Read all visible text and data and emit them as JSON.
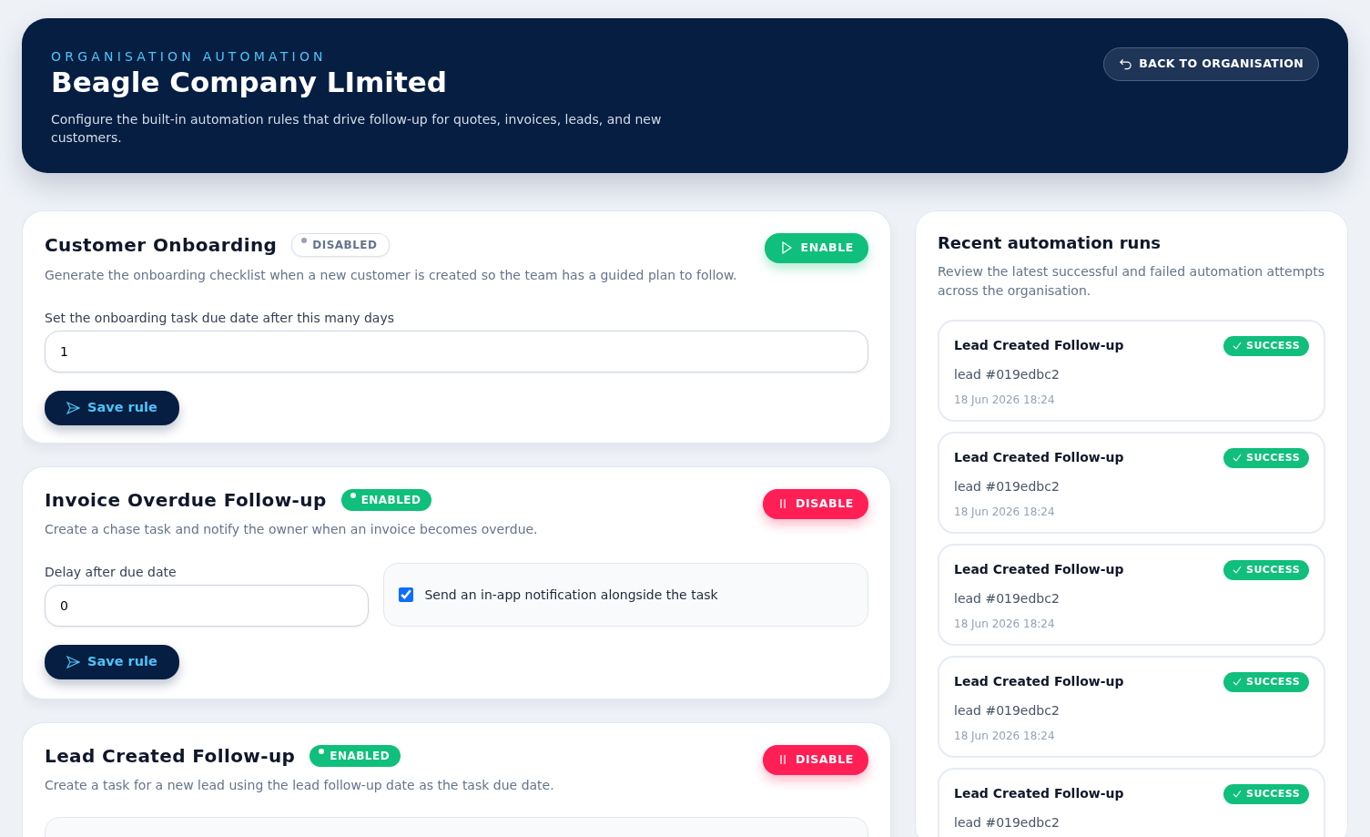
{
  "header": {
    "eyebrow": "ORGANISATION AUTOMATION",
    "title": "Beagle Company LImited",
    "description": "Configure the built-in automation rules that drive follow-up for quotes, invoices, leads, and new customers.",
    "back_button": "BACK TO ORGANISATION"
  },
  "rules": [
    {
      "title": "Customer Onboarding",
      "enabled": false,
      "status_label": "DISABLED",
      "action_label": "ENABLE",
      "description": "Generate the onboarding checklist when a new customer is created so the team has a guided plan to follow.",
      "fields": [
        {
          "kind": "number",
          "label": "Set the onboarding task due date after this many days",
          "value": "1"
        }
      ],
      "save_label": "Save rule"
    },
    {
      "title": "Invoice Overdue Follow-up",
      "enabled": true,
      "status_label": "ENABLED",
      "action_label": "DISABLE",
      "description": "Create a chase task and notify the owner when an invoice becomes overdue.",
      "fields": [
        {
          "kind": "number",
          "label": "Delay after due date",
          "value": "0"
        },
        {
          "kind": "checkbox",
          "label": "Send an in-app notification alongside the task",
          "checked": true
        }
      ],
      "save_label": "Save rule"
    },
    {
      "title": "Lead Created Follow-up",
      "enabled": true,
      "status_label": "ENABLED",
      "action_label": "DISABLE",
      "description": "Create a task for a new lead using the lead follow-up date as the task due date.",
      "note_box": true
    }
  ],
  "recent_runs": {
    "title": "Recent automation runs",
    "description": "Review the latest successful and failed automation attempts across the organisation.",
    "items": [
      {
        "title": "Lead Created Follow-up",
        "status": "SUCCESS",
        "kind": "success",
        "subject": "lead #019edbc2",
        "time": "18 Jun 2026 18:24"
      },
      {
        "title": "Lead Created Follow-up",
        "status": "SUCCESS",
        "kind": "success",
        "subject": "lead #019edbc2",
        "time": "18 Jun 2026 18:24"
      },
      {
        "title": "Lead Created Follow-up",
        "status": "SUCCESS",
        "kind": "success",
        "subject": "lead #019edbc2",
        "time": "18 Jun 2026 18:24"
      },
      {
        "title": "Lead Created Follow-up",
        "status": "SUCCESS",
        "kind": "success",
        "subject": "lead #019edbc2",
        "time": "18 Jun 2026 18:24"
      },
      {
        "title": "Lead Created Follow-up",
        "status": "SUCCESS",
        "kind": "success",
        "subject": "lead #019edbc2"
      }
    ]
  }
}
